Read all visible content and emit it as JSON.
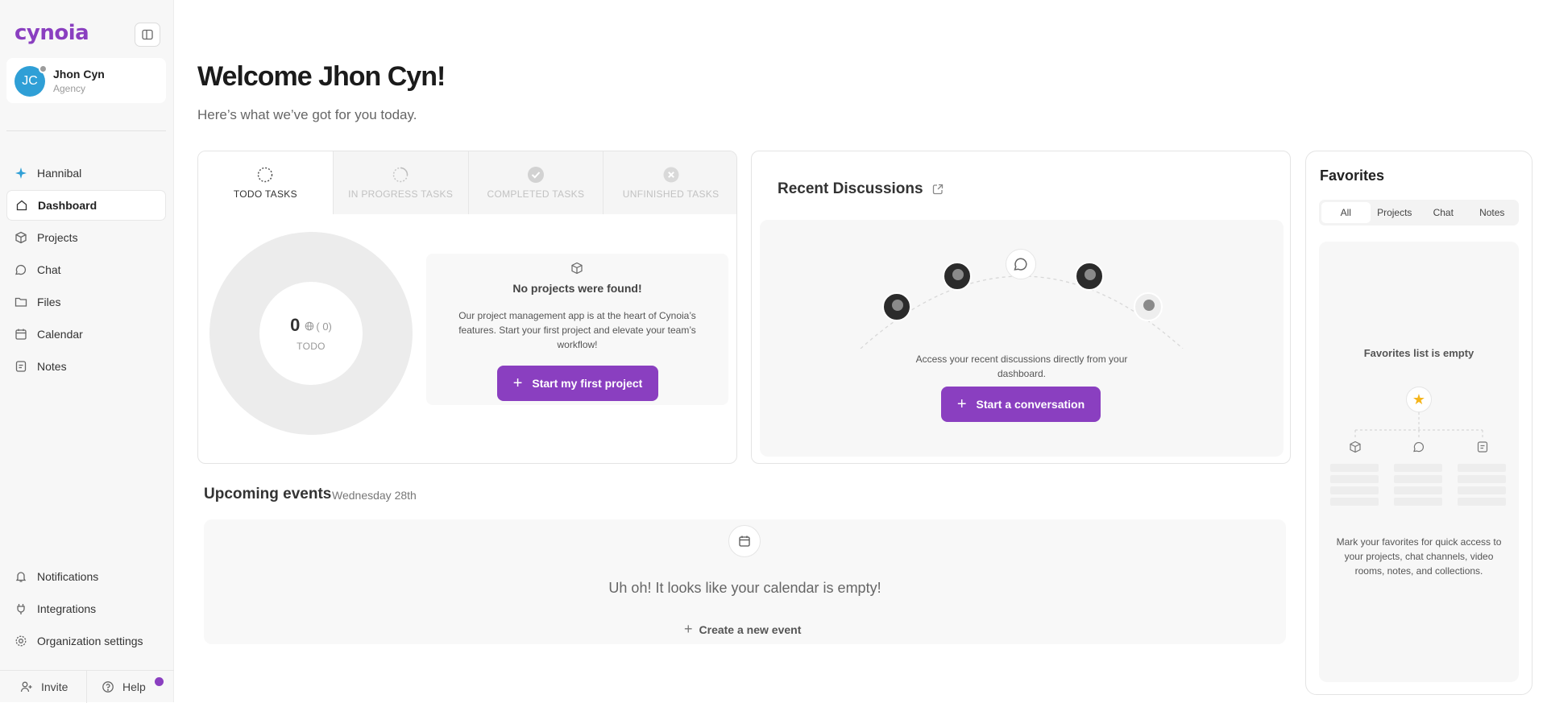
{
  "app": {
    "logo_text": "cynoia",
    "brand_color": "#8a3fc0"
  },
  "user": {
    "initials": "JC",
    "name": "Jhon Cyn",
    "role": "Agency",
    "status": "offline"
  },
  "sidebar": {
    "items": [
      {
        "label": "Hannibal",
        "icon": "sparkle-icon"
      },
      {
        "label": "Dashboard",
        "icon": "home-icon",
        "active": true
      },
      {
        "label": "Projects",
        "icon": "box-icon"
      },
      {
        "label": "Chat",
        "icon": "chat-icon"
      },
      {
        "label": "Files",
        "icon": "folder-icon"
      },
      {
        "label": "Calendar",
        "icon": "calendar-icon"
      },
      {
        "label": "Notes",
        "icon": "note-icon"
      }
    ],
    "bottom_items": [
      {
        "label": "Notifications",
        "icon": "bell-icon"
      },
      {
        "label": "Integrations",
        "icon": "plug-icon"
      },
      {
        "label": "Organization settings",
        "icon": "gear-icon"
      }
    ],
    "footer": {
      "invite": "Invite",
      "help": "Help"
    }
  },
  "header": {
    "title": "Welcome Jhon Cyn!",
    "subtitle": "Here’s what we’ve got for you today."
  },
  "tasks": {
    "tabs": [
      "TODO TASKS",
      "IN PROGRESS TASKS",
      "COMPLETED TASKS",
      "UNFINISHED TASKS"
    ],
    "active_tab": 0,
    "donut": {
      "count": "0",
      "sub_count": "( 0)",
      "label": "TODO"
    },
    "empty": {
      "title": "No projects were found!",
      "text": "Our project management app is at the heart of Cynoia’s features. Start your first project and elevate your team’s workflow!",
      "button": "Start my first project"
    }
  },
  "discussions": {
    "title": "Recent Discussions",
    "text": "Access your recent discussions directly from your dashboard.",
    "button": "Start a conversation"
  },
  "favorites": {
    "title": "Favorites",
    "tabs": [
      "All",
      "Projects",
      "Chat",
      "Notes"
    ],
    "active_tab": 0,
    "empty_title": "Favorites list is empty",
    "text": "Mark your favorites for quick access to your projects, chat channels, video rooms, notes, and collections."
  },
  "events": {
    "title": "Upcoming events",
    "date": "Wednesday 28th",
    "empty": "Uh oh! It looks like your calendar is empty!",
    "create": "Create a new event"
  }
}
